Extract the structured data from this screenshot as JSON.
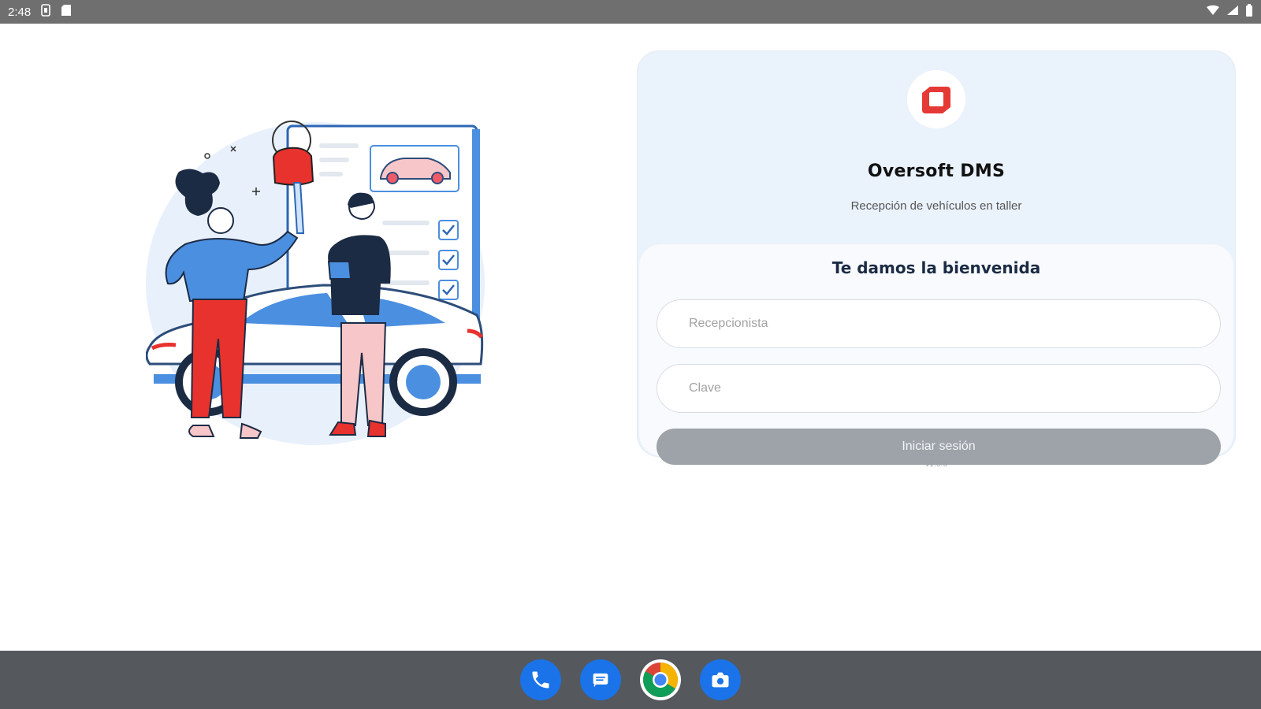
{
  "status_bar": {
    "time": "2:48"
  },
  "app": {
    "name": "Oversoft DMS",
    "subtitle": "Recepción de vehículos en taller",
    "brand_color": "#e53935"
  },
  "login": {
    "welcome": "Te damos la bienvenida",
    "username_placeholder": "Recepcionista",
    "password_placeholder": "Clave",
    "submit_label": "Iniciar sesión",
    "version": "v1.0.6"
  },
  "dock": {
    "apps": [
      "phone",
      "messages",
      "chrome",
      "camera"
    ]
  }
}
